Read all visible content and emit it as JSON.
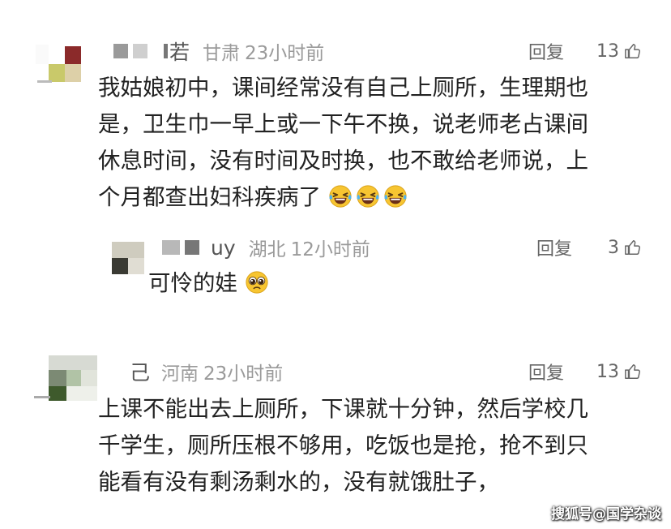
{
  "comments": [
    {
      "name": "若",
      "region": "甘肃",
      "time": "23小时前",
      "reply_label": "回复",
      "likes": "13",
      "lines": [
        "我姑娘初中，课间经常没有自己上厕所，生理期也",
        "是，卫生巾一早上或一下午不换，说老师老占课间",
        "休息时间，没有时间及时换，也不敢给老师说，上",
        "个月都查出妇科疾病了"
      ],
      "emojis": [
        "grin-squint-tears-emoji",
        "grin-squint-tears-emoji",
        "grin-squint-tears-emoji"
      ]
    },
    {
      "name": "uy",
      "region": "湖北",
      "time": "12小时前",
      "reply_label": "回复",
      "likes": "3",
      "lines": [
        "可怜的娃"
      ],
      "emojis": [
        "pleading-face-emoji"
      ]
    },
    {
      "name": "己",
      "region": "河南",
      "time": "23小时前",
      "reply_label": "回复",
      "likes": "13",
      "lines": [
        "上课不能出去上厕所，下课就十分钟，然后学校几",
        "千学生，厕所压根不够用，吃饭也是抢，抢不到只",
        "能看有没有剩汤剩水的，没有就饿肚子，"
      ],
      "emojis": []
    }
  ],
  "watermark": "搜狐号@国学杂谈",
  "colors": {
    "text": "#222222",
    "meta": "#9a9a9a",
    "action": "#666666",
    "emoji_face": "#f7c531"
  }
}
